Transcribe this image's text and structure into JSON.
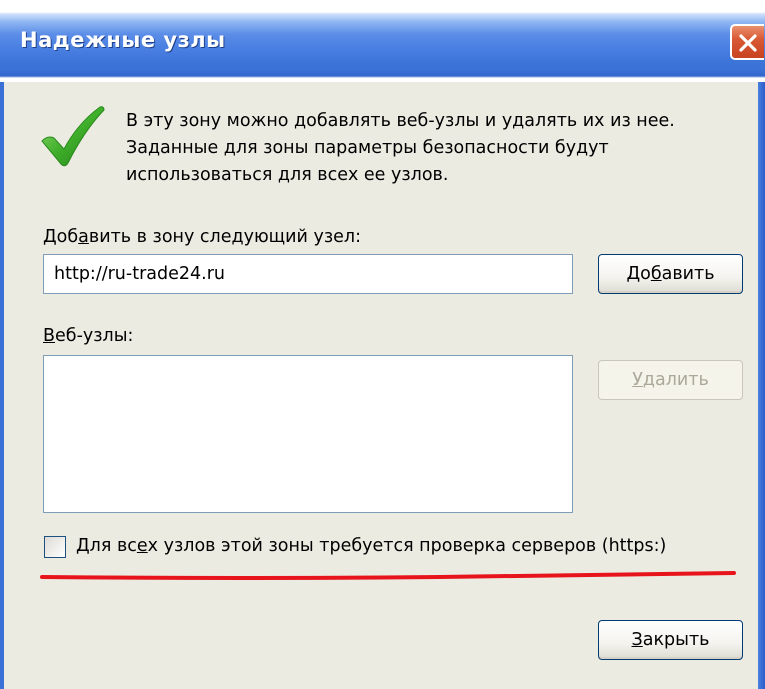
{
  "window": {
    "title": "Надежные узлы",
    "close_icon": "close-icon"
  },
  "description": {
    "icon": "checkmark-icon",
    "lines": [
      "В эту зону можно добавлять веб-узлы и удалять их из нее.",
      "Заданные для зоны параметры безопасности будут",
      "использоваться для всех ее узлов."
    ]
  },
  "add_site": {
    "label_before": "Доб",
    "label_mnemonic": "а",
    "label_after": "вить в зону следующий узел:",
    "input_value": "http://ru-trade24.ru",
    "button_before": "До",
    "button_mnemonic": "б",
    "button_after": "авить"
  },
  "sites": {
    "label_mnemonic": "В",
    "label_after": "еб-узлы:",
    "items": [],
    "remove_before": "",
    "remove_mnemonic": "У",
    "remove_after": "далить",
    "remove_enabled": false
  },
  "https_check": {
    "checked": false,
    "label_before": "Для вс",
    "label_mnemonic": "е",
    "label_after": "х узлов этой зоны требуется проверка серверов (https:)"
  },
  "close_button": {
    "before": "",
    "mnemonic": "З",
    "after": "акрыть"
  },
  "annotation": {
    "color": "#e8141c"
  }
}
